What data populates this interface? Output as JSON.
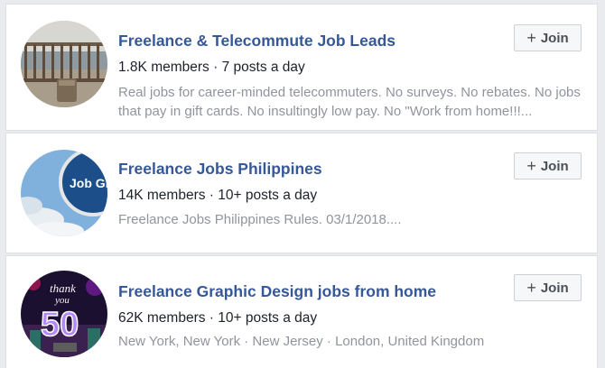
{
  "groups": [
    {
      "name": "Freelance & Telecommute Job Leads",
      "members": "1.8K members",
      "separator": "·",
      "activity": "7 posts a day",
      "description": "Real jobs for career-minded telecommuters. No surveys. No rebates. No jobs that pay in gift cards. No insultingly low pay. No \"Work from home!!!...",
      "join_label": "Join",
      "join_icon": "plus-icon",
      "avatar_icon": "balcony-photo"
    },
    {
      "name": "Freelance Jobs Philippines",
      "members": "14K members",
      "separator": "·",
      "activity": "10+ posts a day",
      "description": "Freelance Jobs Philippines Rules. 03/1/2018....",
      "join_label": "Join",
      "join_icon": "plus-icon",
      "avatar_icon": "job-group-sign-photo",
      "avatar_text": "Job Gro"
    },
    {
      "name": "Freelance Graphic Design jobs from home",
      "members": "62K members",
      "separator": "·",
      "activity": "10+ posts a day",
      "description": "New York, New York · New Jersey · London, United Kingdom",
      "join_label": "Join",
      "join_icon": "plus-icon",
      "avatar_icon": "thank-you-50-photo",
      "avatar_text_top": "thank",
      "avatar_text_mid": "you",
      "avatar_text_big": "50"
    }
  ],
  "colors": {
    "link": "#365899",
    "text": "#1d2129",
    "muted": "#90949c",
    "background": "#e9ebee",
    "button_bg": "#f6f7f9"
  }
}
